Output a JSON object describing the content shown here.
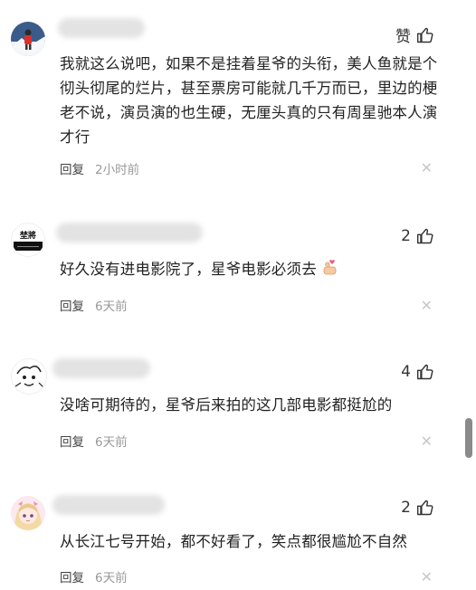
{
  "comments": [
    {
      "like_label": "赞",
      "text": "我就这么说吧，如果不是挂着星爷的头衔，美人鱼就是个彻头彻尾的烂片，甚至票房可能就几千万而已，里边的梗老不说，演员演的也生硬，无厘头真的只有周星驰本人演才行",
      "reply_label": "回复",
      "time": "2小时前",
      "avatar_icon": "mountain-climber-avatar"
    },
    {
      "like_count": "2",
      "text": "好久没有进电影院了，星爷电影必须去",
      "reply_label": "回复",
      "time": "6天前",
      "avatar_icon": "calligraphy-logo-avatar",
      "avatar_text": "埜將",
      "emoji": "finger-heart-emoji"
    },
    {
      "like_count": "4",
      "text": "没啥可期待的，星爷后来拍的这几部电影都挺尬的",
      "reply_label": "回复",
      "time": "6天前",
      "avatar_icon": "cartoon-doodle-avatar"
    },
    {
      "like_count": "2",
      "text": "从长江七号开始，都不好看了，笑点都很尴尬不自然",
      "reply_label": "回复",
      "time": "6天前",
      "avatar_icon": "anime-girl-avatar"
    }
  ]
}
